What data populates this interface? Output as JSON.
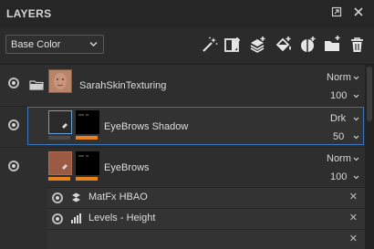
{
  "panel": {
    "title": "LAYERS",
    "title_icons": [
      "expand-icon",
      "close-icon"
    ]
  },
  "toolbar": {
    "channel_value": "Base Color",
    "icons": [
      "magic-wand-icon",
      "add-mask-icon",
      "add-layer-icon",
      "fill-icon",
      "add-effect-icon",
      "new-folder-icon",
      "trash-icon"
    ]
  },
  "layers": [
    {
      "name": "SarahSkinTexturing",
      "blend": "Norm",
      "opacity": "100",
      "type": "folder"
    },
    {
      "name": "EyeBrows Shadow",
      "blend": "Drk",
      "opacity": "50",
      "selected": true
    },
    {
      "name": "EyeBrows",
      "blend": "Norm",
      "opacity": "100"
    }
  ],
  "effects": [
    {
      "name": "MatFx HBAO",
      "icon": "substance-icon"
    },
    {
      "name": "Levels - Height",
      "icon": "levels-icon"
    }
  ],
  "colors": {
    "accent": "#e8821e",
    "selection": "#3a78c2"
  }
}
